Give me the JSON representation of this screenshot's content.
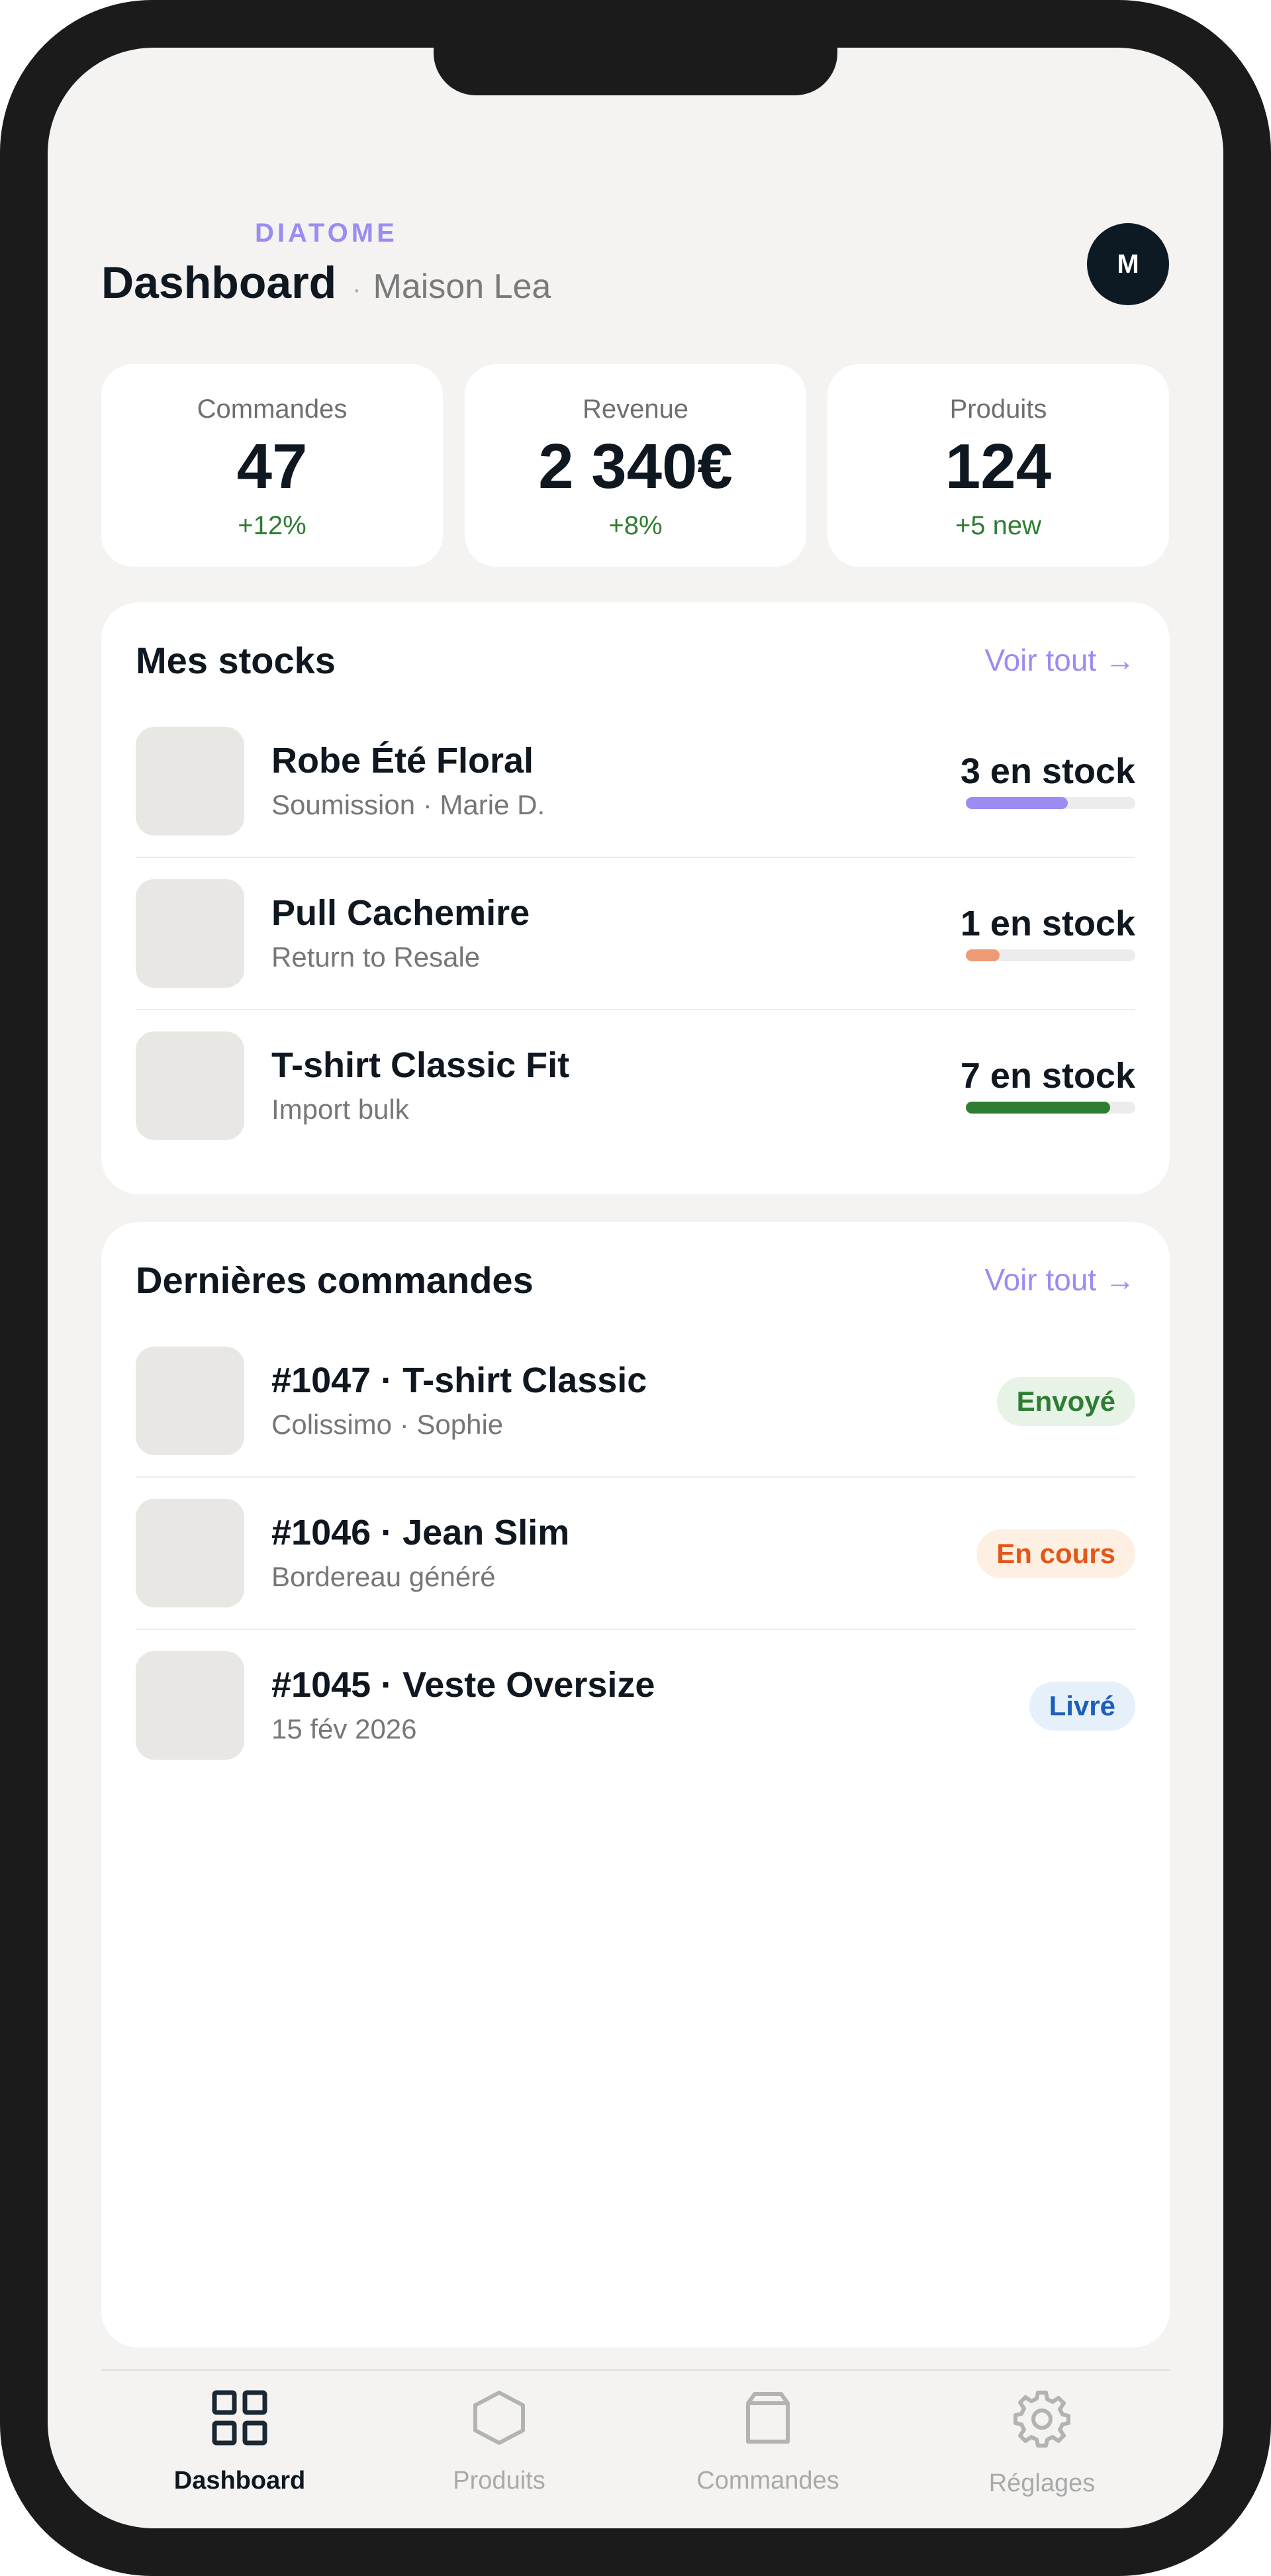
{
  "header": {
    "brand": "DIATOME",
    "title": "Dashboard",
    "separator": "·",
    "store": "Maison Lea",
    "avatar_initial": "M"
  },
  "stats": [
    {
      "label": "Commandes",
      "value": "47",
      "delta": "+12%"
    },
    {
      "label": "Revenue",
      "value": "2 340€",
      "delta": "+8%"
    },
    {
      "label": "Produits",
      "value": "124",
      "delta": "+5 new"
    }
  ],
  "stocks": {
    "title": "Mes stocks",
    "see_all": "Voir tout →",
    "items": [
      {
        "name": "Robe Été Floral",
        "sub": "Soumission · Marie D.",
        "qty": "3 en stock",
        "level": 0.6,
        "color": "#9b8cf2"
      },
      {
        "name": "Pull Cachemire",
        "sub": "Return to Resale",
        "qty": "1 en stock",
        "level": 0.2,
        "color": "#ee9a76"
      },
      {
        "name": "T-shirt Classic Fit",
        "sub": "Import bulk",
        "qty": "7 en stock",
        "level": 0.85,
        "color": "#2e7d32"
      }
    ]
  },
  "orders": {
    "title": "Dernières commandes",
    "see_all": "Voir tout →",
    "items": [
      {
        "title": "#1047 · T-shirt Classic",
        "sub": "Colissimo · Sophie",
        "status": "Envoyé",
        "status_fg": "#2e7d32",
        "status_bg": "#e6f3e6"
      },
      {
        "title": "#1046 · Jean Slim",
        "sub": "Bordereau généré",
        "status": "En cours",
        "status_fg": "#e2581b",
        "status_bg": "#fdf0e3"
      },
      {
        "title": "#1045 · Veste Oversize",
        "sub": "15 fév 2026",
        "status": "Livré",
        "status_fg": "#1c5fb8",
        "status_bg": "#e5f0fb"
      }
    ]
  },
  "tabs": [
    {
      "label": "Dashboard",
      "icon": "grid-icon",
      "active": true
    },
    {
      "label": "Produits",
      "icon": "hexagon-icon",
      "active": false
    },
    {
      "label": "Commandes",
      "icon": "box-icon",
      "active": false
    },
    {
      "label": "Réglages",
      "icon": "gear-icon",
      "active": false
    }
  ],
  "colors": {
    "accent": "#9b8cf2",
    "positive": "#2e7d32",
    "dark": "#0f1720"
  }
}
